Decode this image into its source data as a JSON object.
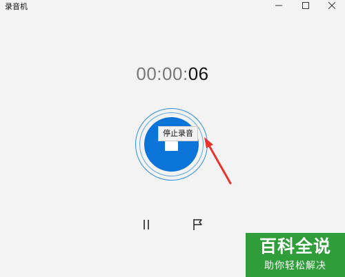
{
  "window": {
    "title": "录音机",
    "controls": [
      "minimize-icon",
      "maximize-icon",
      "close-icon"
    ]
  },
  "timer": {
    "dim_part": "00:00:",
    "seconds": "06"
  },
  "record": {
    "tooltip": "停止录音",
    "button_color": "#0a74d8"
  },
  "controls": {
    "pause_icon": "pause-icon",
    "marker_icon": "flag-icon"
  },
  "watermark": {
    "main": "百科全说",
    "sub": "助你轻松解决",
    "color": "#2f9e3a"
  },
  "annotation": {
    "arrow_color": "#e8322b"
  }
}
